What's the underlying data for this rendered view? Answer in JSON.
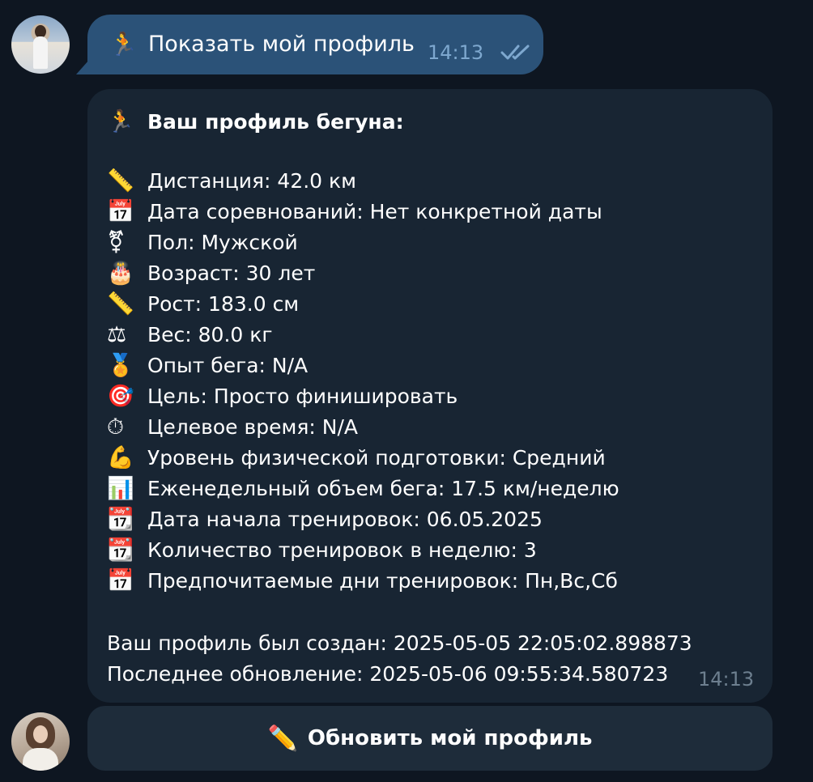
{
  "outgoing": {
    "emoji": "🏃",
    "text": "Показать мой профиль",
    "time": "14:13",
    "checks_color": "#7ea8cf"
  },
  "incoming": {
    "title_emoji": "🏃",
    "title": "Ваш профиль бегуна:",
    "rows": [
      {
        "emoji": "📏",
        "text": "Дистанция: 42.0 км"
      },
      {
        "emoji": "📅",
        "text": "Дата соревнований: Нет конкретной даты"
      },
      {
        "emoji": "⚧",
        "text": "Пол: Мужской"
      },
      {
        "emoji": "🎂",
        "text": "Возраст: 30 лет"
      },
      {
        "emoji": "📏",
        "text": "Рост: 183.0 см"
      },
      {
        "emoji": "⚖",
        "text": "Вес: 80.0 кг"
      },
      {
        "emoji": "🏅",
        "text": "Опыт бега: N/A"
      },
      {
        "emoji": "🎯",
        "text": "Цель: Просто финишировать"
      },
      {
        "emoji": "⏱",
        "text": "Целевое время: N/A"
      },
      {
        "emoji": "💪",
        "text": "Уровень физической подготовки: Средний"
      },
      {
        "emoji": "📊",
        "text": "Еженедельный объем бега: 17.5 км/неделю"
      },
      {
        "emoji": "📆",
        "text": "Дата начала тренировок: 06.05.2025"
      },
      {
        "emoji": "📆",
        "text": "Количество тренировок в неделю: 3"
      },
      {
        "emoji": "📅",
        "text": "Предпочитаемые дни тренировок: Пн,Вс,Сб"
      }
    ],
    "created": "Ваш профиль был создан: 2025-05-05 22:05:02.898873",
    "updated": "Последнее обновление: 2025-05-06 09:55:34.580723",
    "time": "14:13"
  },
  "keyboard_button": {
    "emoji": "✏️",
    "label": "Обновить мой профиль"
  },
  "colors": {
    "background": "#0e1621",
    "outgoing_bubble": "#2b5278",
    "incoming_bubble": "#182533",
    "button": "#1e2c3a"
  }
}
